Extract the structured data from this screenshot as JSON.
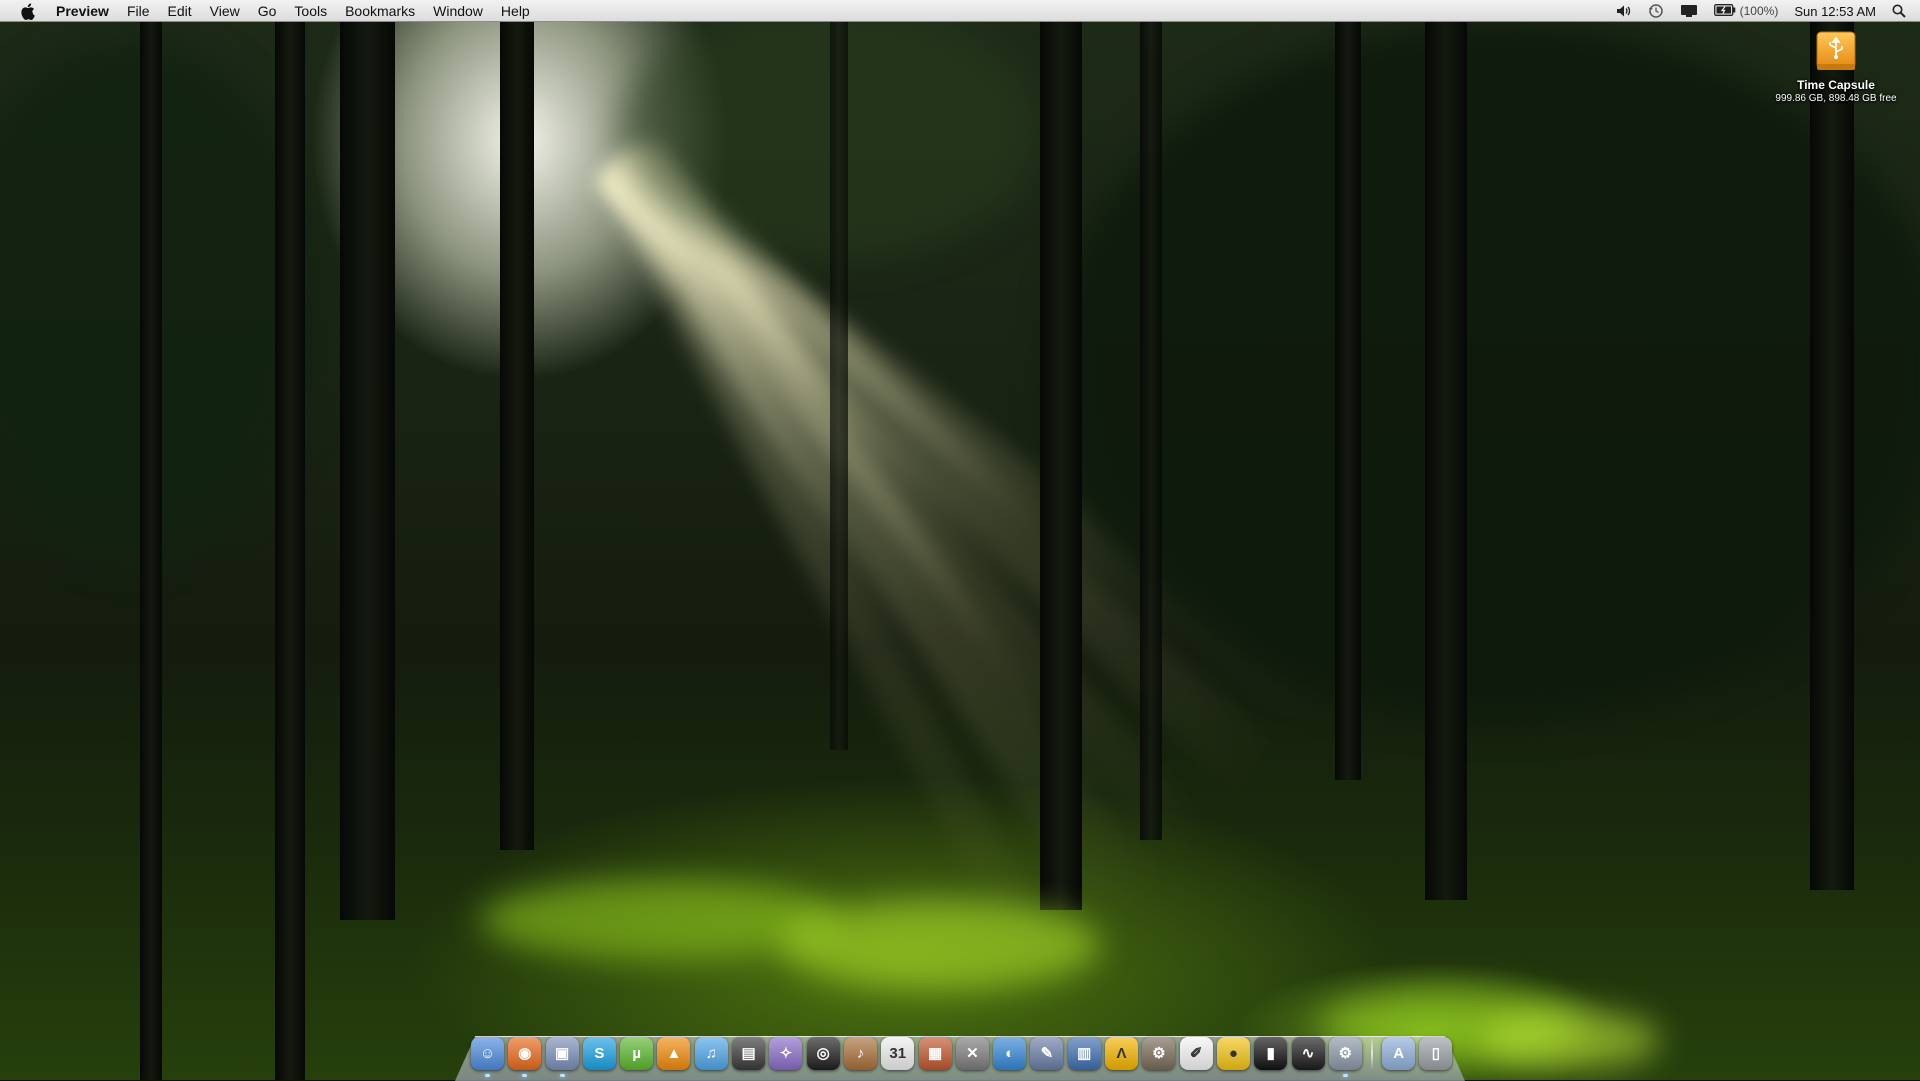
{
  "menubar": {
    "app_name": "Preview",
    "menus": [
      "File",
      "Edit",
      "View",
      "Go",
      "Tools",
      "Bookmarks",
      "Window",
      "Help"
    ],
    "status": {
      "battery_percent": "(100%)",
      "clock": "Sun 12:53 AM"
    },
    "icons": [
      "apple-icon",
      "volume-icon",
      "time-machine-icon",
      "display-icon",
      "battery-icon",
      "spotlight-icon"
    ]
  },
  "desktop": {
    "drive": {
      "name": "Time Capsule",
      "info": "999.86 GB, 898.48 GB free",
      "icon": "usb-drive-icon",
      "color": "#f0a326"
    }
  },
  "dock": {
    "apps": [
      {
        "icon": "finder-icon",
        "color": "#4d8be0",
        "glyph": "☺",
        "running": true
      },
      {
        "icon": "firefox-icon",
        "color": "#e86a1c",
        "glyph": "◉",
        "running": true
      },
      {
        "icon": "preview-icon",
        "color": "#7a8fb8",
        "glyph": "▣",
        "running": true
      },
      {
        "icon": "skype-icon",
        "color": "#1ba1e2",
        "glyph": "S",
        "running": false
      },
      {
        "icon": "utorrent-icon",
        "color": "#5cb82e",
        "glyph": "µ",
        "running": false
      },
      {
        "icon": "vlc-icon",
        "color": "#f28b0c",
        "glyph": "▲",
        "running": false
      },
      {
        "icon": "itunes-icon",
        "color": "#4fa6e8",
        "glyph": "♫",
        "running": false
      },
      {
        "icon": "imovie-icon",
        "color": "#3a3a3a",
        "glyph": "▤",
        "running": false
      },
      {
        "icon": "iphoto-icon",
        "color": "#8a6cc9",
        "glyph": "✧",
        "running": false
      },
      {
        "icon": "aperture-icon",
        "color": "#1f1f1f",
        "glyph": "◎",
        "running": false
      },
      {
        "icon": "garageband-icon",
        "color": "#a8703a",
        "glyph": "♪",
        "running": false
      },
      {
        "icon": "ical-icon",
        "color": "#eeeeee",
        "glyph": "31",
        "running": false
      },
      {
        "icon": "photo-booth-icon",
        "color": "#c2572d",
        "glyph": "▦",
        "running": false
      },
      {
        "icon": "tools-icon",
        "color": "#7c7c7c",
        "glyph": "✕",
        "running": false
      },
      {
        "icon": "dvd-player-icon",
        "color": "#3487d6",
        "glyph": "◐",
        "running": false
      },
      {
        "icon": "xcode-icon",
        "color": "#6b7ea8",
        "glyph": "✎",
        "running": false
      },
      {
        "icon": "dashboard-icon",
        "color": "#3e6fb0",
        "glyph": "▥",
        "running": false
      },
      {
        "icon": "adium-icon",
        "color": "#f5b400",
        "glyph": "Λ",
        "running": false
      },
      {
        "icon": "automator-icon",
        "color": "#7a6a58",
        "glyph": "⚙",
        "running": false
      },
      {
        "icon": "textedit-icon",
        "color": "#f4f4f4",
        "glyph": "✐",
        "running": false
      },
      {
        "icon": "cyberduck-icon",
        "color": "#f3c315",
        "glyph": "●",
        "running": false
      },
      {
        "icon": "terminal-icon",
        "color": "#111111",
        "glyph": "▮",
        "running": false
      },
      {
        "icon": "activity-monitor-icon",
        "color": "#1c1c1c",
        "glyph": "∿",
        "running": false
      },
      {
        "icon": "system-preferences-icon",
        "color": "#8b97a8",
        "glyph": "⚙",
        "running": true
      }
    ],
    "stacks": [
      {
        "icon": "applications-stack-icon",
        "color": "#8fb0d8",
        "glyph": "A"
      },
      {
        "icon": "trash-icon",
        "color": "#9aa0a6",
        "glyph": "▯"
      }
    ]
  }
}
